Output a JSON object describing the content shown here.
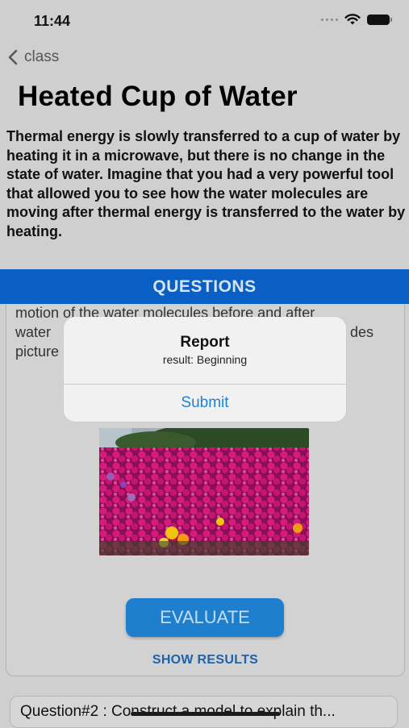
{
  "status_bar": {
    "time": "11:44"
  },
  "nav": {
    "back_label": "class"
  },
  "page": {
    "title": "Heated Cup of Water",
    "description": "Thermal energy is slowly transferred to a cup of water by heating it in a microwave, but there is no change in the state of water. Imagine that you had a very powerful tool that allowed you to see how the water molecules are moving after thermal energy is transferred to the water by heating."
  },
  "questions_header": "QUESTIONS",
  "question_card": {
    "text_line1": "motion of the water molecules before and after",
    "text_line2_start": "water",
    "text_line2_end": "des",
    "text_line3": "picture",
    "evaluate_label": "EVALUATE",
    "show_results_label": "SHOW RESULTS"
  },
  "next_question": {
    "label": "Question#2 : Construct a model to explain th..."
  },
  "alert": {
    "title": "Report",
    "message": "result: Beginning",
    "submit_label": "Submit"
  },
  "colors": {
    "accent": "#0a5fc4",
    "button": "#1e7fcf",
    "link": "#1f62a8",
    "alert_action": "#1f80d8"
  }
}
